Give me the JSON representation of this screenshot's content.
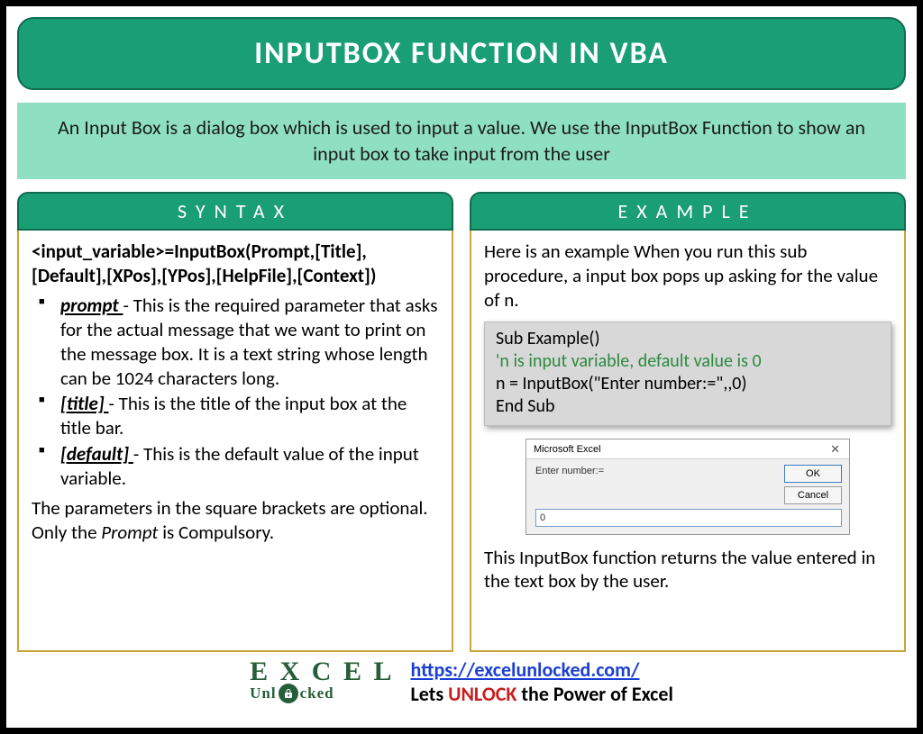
{
  "title": "INPUTBOX FUNCTION IN VBA",
  "intro": "An Input Box is a dialog box which is used to input a value. We use the InputBox Function to show an input box to take input from the user",
  "syntax": {
    "header": "SYNTAX",
    "signature": "<input_variable>=InputBox(Prompt,[Title],[Default],[XPos],[YPos],[HelpFile],[Context])",
    "params": [
      {
        "name": "prompt ",
        "dash": "- ",
        "desc": "This is the required parameter that asks for the actual message that we want to print on the message box. It is a text string whose length can be 1024 characters long."
      },
      {
        "name": "[title] ",
        "dash": "- ",
        "desc": "This is the title of the input box at the title bar."
      },
      {
        "name": "[default] ",
        "dash": "- ",
        "desc": "This is the default value of the input variable."
      }
    ],
    "optional_note_pre": "The parameters in the square brackets are optional. Only the ",
    "optional_note_em": "Prompt",
    "optional_note_post": " is Compulsory."
  },
  "example": {
    "header": "EXAMPLE",
    "desc": "Here is an example When you run this sub procedure, a input box pops up asking for the value of n.",
    "code": {
      "l1": "Sub Example()",
      "l2": "'n is input variable, default value is 0",
      "l3": "n = InputBox(\"Enter number:=\",,0)",
      "l4": "End Sub"
    },
    "dialog": {
      "title": "Microsoft Excel",
      "prompt": "Enter number:=",
      "ok": "OK",
      "cancel": "Cancel",
      "value": "0"
    },
    "return_text": "This InputBox function returns the value entered in the text box by the user."
  },
  "footer": {
    "logo_row1": "E X C E L",
    "logo_row2a": "Unl",
    "logo_row2b": "cked",
    "url": "https://excelunlocked.com/",
    "tag_pre": "Lets ",
    "tag_unlock": "UNLOCK",
    "tag_post": " the Power of Excel"
  }
}
